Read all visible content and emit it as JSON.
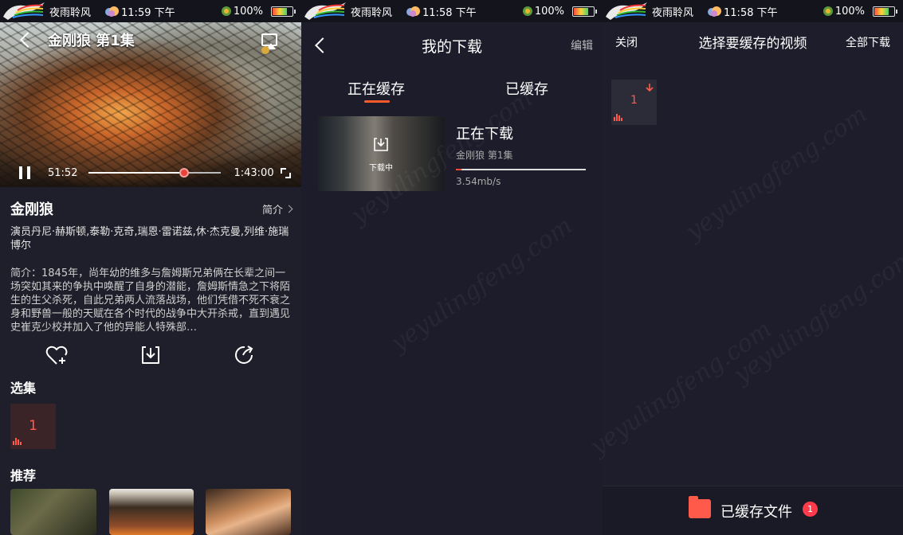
{
  "status_bar": {
    "carrier": "夜雨聆风",
    "panels": [
      {
        "time": "11:59 下午",
        "battery": "100%"
      },
      {
        "time": "11:58 下午",
        "battery": "100%"
      },
      {
        "time": "11:58 下午",
        "battery": "100%"
      }
    ]
  },
  "player": {
    "title": "金刚狼 第1集",
    "current_time": "51:52",
    "duration": "1:43:00",
    "progress": 0.72
  },
  "detail": {
    "title": "金刚狼",
    "intro_link": "简介",
    "cast": "演员丹尼·赫斯顿,泰勒·克奇,瑞恩·雷诺兹,休·杰克曼,列维·施瑞博尔",
    "synopsis": "简介：1845年，尚年幼的维多与詹姆斯兄弟俩在长辈之间一场突如其来的争执中唤醒了自身的潜能，詹姆斯情急之下将陌生的生父杀死，自此兄弟两人流落战场，他们凭借不死不衰之身和野兽一般的天赋在各个时代的战争中大开杀戒，直到遇见史崔克少校并加入了他的异能人特殊部…",
    "episodes_heading": "选集",
    "episode_number": "1",
    "recommend_heading": "推荐"
  },
  "downloads": {
    "title": "我的下载",
    "edit_label": "编辑",
    "tabs": [
      "正在缓存",
      "已缓存"
    ],
    "item": {
      "thumb_label": "下载中",
      "status": "正在下载",
      "name": "金刚狼  第1集",
      "speed": "3.54mb/s",
      "progress": 0.04
    }
  },
  "cache_select": {
    "close_label": "关闭",
    "title": "选择要缓存的视频",
    "download_all_label": "全部下载",
    "episode_number": "1",
    "cached_files_label": "已缓存文件",
    "cached_count": "1"
  },
  "watermark": "yeyulingfeng.com",
  "colors": {
    "accent": "#ff5a4a",
    "tab_underline": "#ff5a2a",
    "background": "#1c1c2a"
  }
}
